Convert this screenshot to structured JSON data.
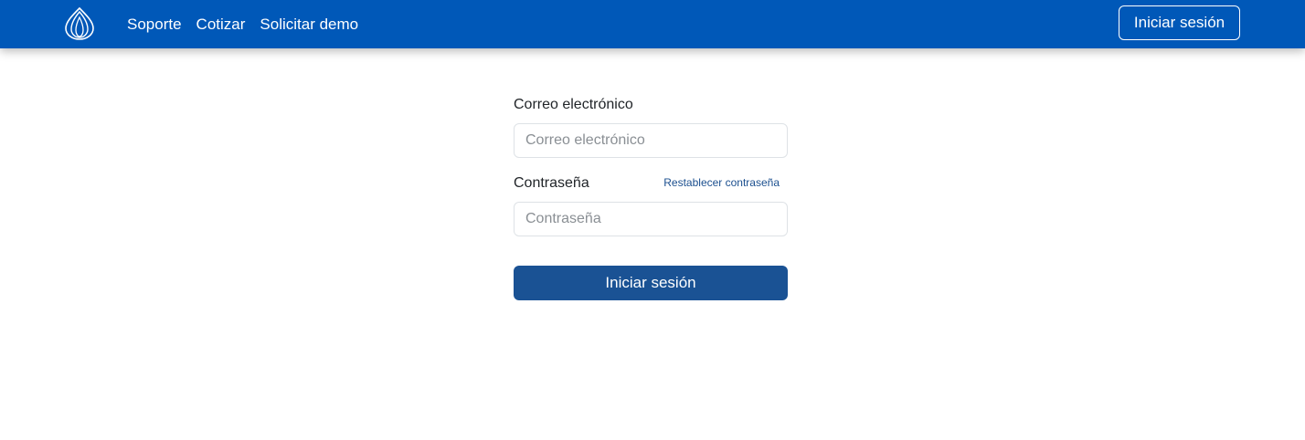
{
  "colors": {
    "navbar_bg": "#0058b8",
    "primary_button": "#1a5294",
    "link": "#1b4f8f"
  },
  "navbar": {
    "logo_icon": "flame-outline-logo-icon",
    "links": [
      {
        "label": "Soporte"
      },
      {
        "label": "Cotizar"
      },
      {
        "label": "Solicitar demo"
      }
    ],
    "login_label": "Iniciar sesión"
  },
  "form": {
    "email": {
      "label": "Correo electrónico",
      "placeholder": "Correo electrónico",
      "value": ""
    },
    "password": {
      "label": "Contraseña",
      "placeholder": "Contraseña",
      "value": "",
      "reset_link": "Restablecer contraseña"
    },
    "submit_label": "Iniciar sesión"
  }
}
